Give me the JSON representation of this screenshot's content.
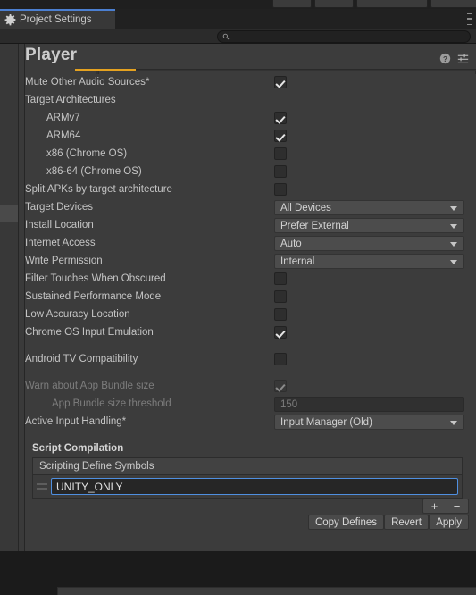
{
  "window": {
    "tab_label": "Project Settings",
    "tab_icon": "gear-icon",
    "menu_icon": "vertical-dots-icon"
  },
  "search": {
    "value": "",
    "placeholder": "",
    "icon": "search-icon"
  },
  "header": {
    "title": "Player",
    "help_icon": "help-icon",
    "preset_icon": "preset-settings-icon"
  },
  "settings": {
    "rows": [
      {
        "label": "Mute Other Audio Sources*",
        "indent": 0,
        "control": "checkbox",
        "checked": true,
        "disabled": false
      },
      {
        "label": "Target Architectures",
        "indent": 0,
        "control": "none",
        "checked": false,
        "disabled": false
      },
      {
        "label": "ARMv7",
        "indent": 1,
        "control": "checkbox",
        "checked": true,
        "disabled": false
      },
      {
        "label": "ARM64",
        "indent": 1,
        "control": "checkbox",
        "checked": true,
        "disabled": false
      },
      {
        "label": "x86 (Chrome OS)",
        "indent": 1,
        "control": "checkbox",
        "checked": false,
        "disabled": false
      },
      {
        "label": "x86-64 (Chrome OS)",
        "indent": 1,
        "control": "checkbox",
        "checked": false,
        "disabled": false
      },
      {
        "label": "Split APKs by target architecture",
        "indent": 0,
        "control": "checkbox",
        "checked": false,
        "disabled": false
      },
      {
        "label": "Target Devices",
        "indent": 0,
        "control": "dropdown",
        "value": "All Devices",
        "disabled": false
      },
      {
        "label": "Install Location",
        "indent": 0,
        "control": "dropdown",
        "value": "Prefer External",
        "disabled": false
      },
      {
        "label": "Internet Access",
        "indent": 0,
        "control": "dropdown",
        "value": "Auto",
        "disabled": false
      },
      {
        "label": "Write Permission",
        "indent": 0,
        "control": "dropdown",
        "value": "Internal",
        "disabled": false
      },
      {
        "label": "Filter Touches When Obscured",
        "indent": 0,
        "control": "checkbox",
        "checked": false,
        "disabled": false
      },
      {
        "label": "Sustained Performance Mode",
        "indent": 0,
        "control": "checkbox",
        "checked": false,
        "disabled": false
      },
      {
        "label": "Low Accuracy Location",
        "indent": 0,
        "control": "checkbox",
        "checked": false,
        "disabled": false
      },
      {
        "label": "Chrome OS Input Emulation",
        "indent": 0,
        "control": "checkbox",
        "checked": true,
        "disabled": false
      },
      {
        "label": "",
        "indent": 0,
        "control": "spacer",
        "checked": false,
        "disabled": false
      },
      {
        "label": "Android TV Compatibility",
        "indent": 0,
        "control": "checkbox",
        "checked": false,
        "disabled": false
      },
      {
        "label": "",
        "indent": 0,
        "control": "spacer",
        "checked": false,
        "disabled": false
      },
      {
        "label": "Warn about App Bundle size",
        "indent": 0,
        "control": "checkbox",
        "checked": true,
        "disabled": true
      },
      {
        "label": "App Bundle size threshold",
        "indent": 2,
        "control": "number",
        "value": "150",
        "disabled": true
      },
      {
        "label": "Active Input Handling*",
        "indent": 0,
        "control": "dropdown",
        "value": "Input Manager (Old)",
        "disabled": false
      }
    ]
  },
  "script_compilation": {
    "section_title": "Script Compilation",
    "list_header": "Scripting Define Symbols",
    "entries": [
      {
        "value": "UNITY_ONLY"
      }
    ],
    "add_label": "+",
    "remove_label": "−",
    "copy_defines_label": "Copy Defines",
    "revert_label": "Revert",
    "apply_label": "Apply"
  },
  "colors": {
    "accent_blue": "#4b7fd1",
    "active_tab_orange": "#e5a220",
    "panel_bg": "#3c3c3c",
    "window_bg": "#212121"
  }
}
